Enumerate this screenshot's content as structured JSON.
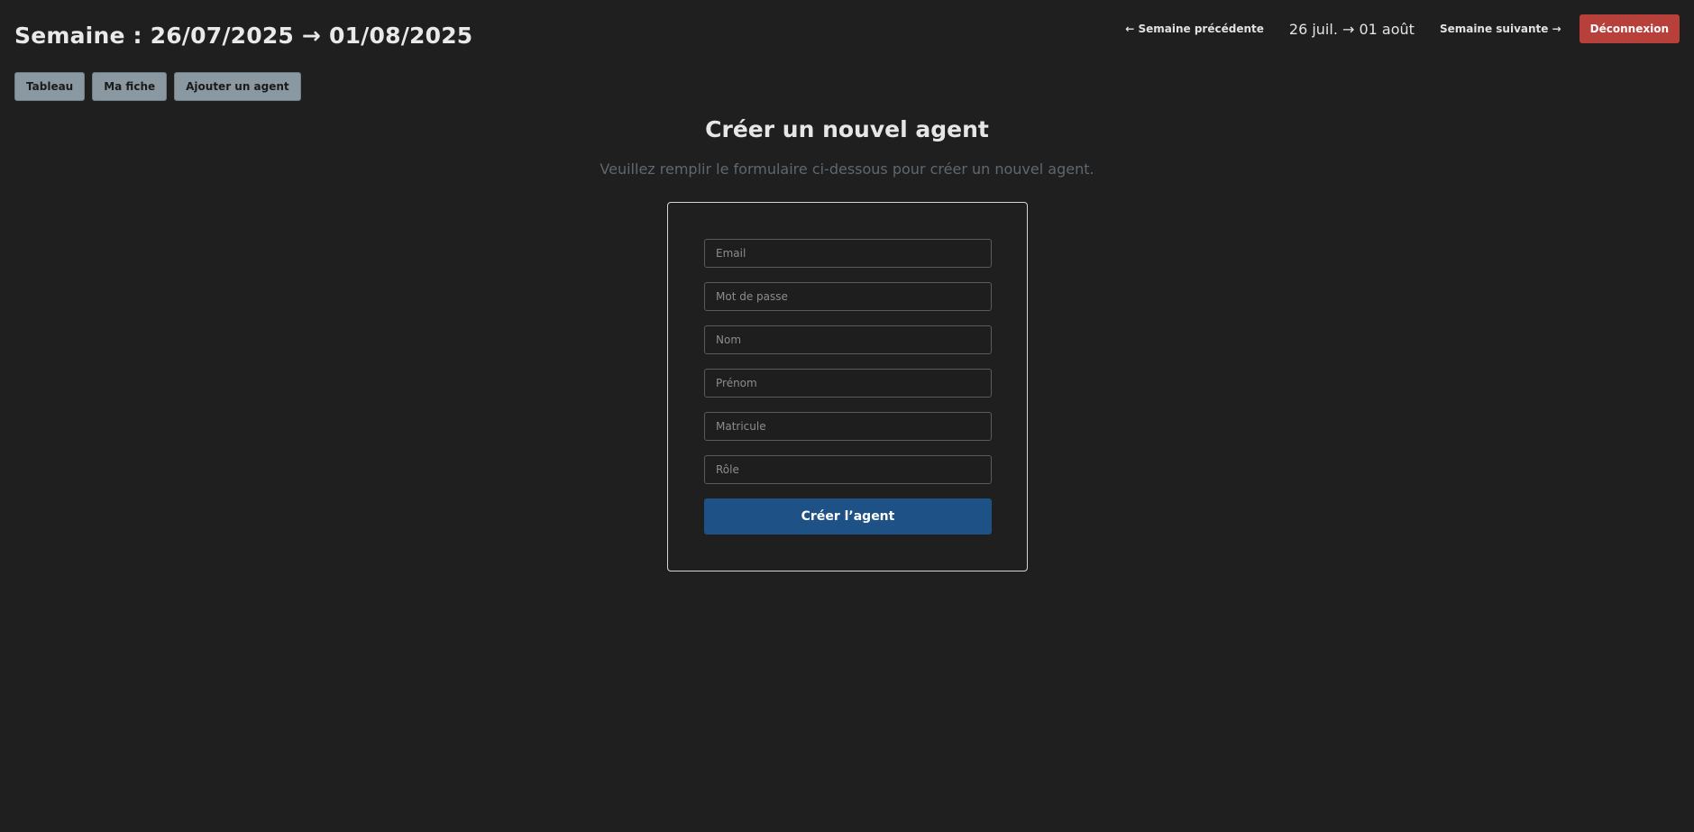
{
  "header": {
    "title": "Semaine : 26/07/2025 → 01/08/2025",
    "prev_week_label": "← Semaine précédente",
    "week_range": "26 juil. → 01 août",
    "next_week_label": "Semaine suivante →",
    "logout_label": "Déconnexion"
  },
  "tabs": [
    {
      "label": "Tableau"
    },
    {
      "label": "Ma fiche"
    },
    {
      "label": "Ajouter un agent"
    }
  ],
  "form": {
    "title": "Créer un nouvel agent",
    "subtitle": "Veuillez remplir le formulaire ci-dessous pour créer un nouvel agent.",
    "fields": {
      "email": {
        "placeholder": "Email",
        "value": ""
      },
      "password": {
        "placeholder": "Mot de passe",
        "value": ""
      },
      "nom": {
        "placeholder": "Nom",
        "value": ""
      },
      "prenom": {
        "placeholder": "Prénom",
        "value": ""
      },
      "matricule": {
        "placeholder": "Matricule",
        "value": ""
      },
      "role": {
        "placeholder": "Rôle",
        "value": ""
      }
    },
    "submit_label": "Créer l’agent"
  },
  "colors": {
    "background": "#1f1f1f",
    "logout": "#b8403a",
    "tab": "#8a99a1",
    "submit": "#1e5286"
  }
}
